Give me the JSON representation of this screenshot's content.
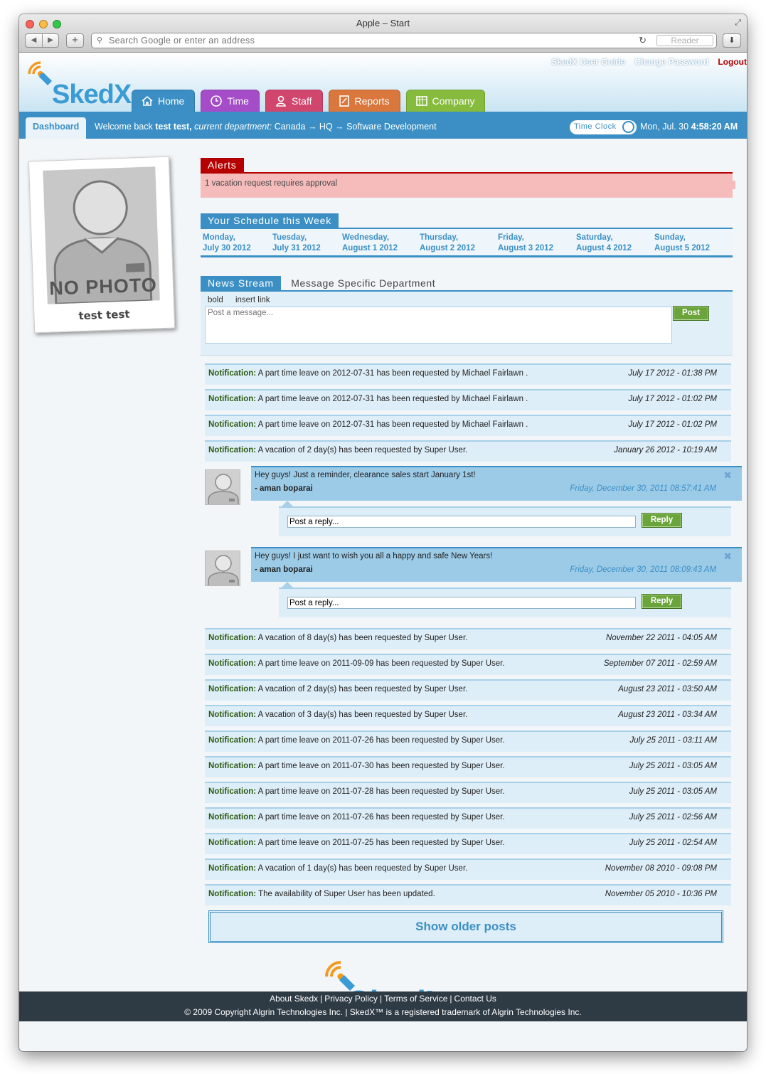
{
  "browser": {
    "title": "Apple – Start",
    "address_placeholder": "Search Google or enter an address",
    "reader_label": "Reader"
  },
  "brand": {
    "logo_text": "SkedX",
    "accent": "#3b8fc4"
  },
  "toplinks": [
    "SkedX User Guide",
    "Change Password",
    "Logout"
  ],
  "tabs": [
    {
      "label": "Home",
      "color": "#3b8fc4",
      "icon": "home-icon"
    },
    {
      "label": "Time",
      "color": "#a54dc8",
      "icon": "clock-icon"
    },
    {
      "label": "Staff",
      "color": "#d1466d",
      "icon": "person-icon"
    },
    {
      "label": "Reports",
      "color": "#d9773d",
      "icon": "report-icon"
    },
    {
      "label": "Company",
      "color": "#86bb3d",
      "icon": "calendar-icon"
    }
  ],
  "subbar": {
    "dashboard": "Dashboard",
    "welcome_prefix": "Welcome back",
    "user": "test test,",
    "dept_label": "current department:",
    "dept_path": "Canada → HQ → Software Development",
    "time_clock": "Time Clock",
    "date": "Mon, Jul. 30",
    "time": "4:58:20 AM"
  },
  "profile": {
    "photo_text": "NO PHOTO",
    "name": "test test"
  },
  "alerts": {
    "title": "Alerts",
    "message": "1 vacation request requires approval"
  },
  "schedule": {
    "title": "Your Schedule this Week",
    "days": [
      {
        "day": "Monday,",
        "date": "July 30 2012"
      },
      {
        "day": "Tuesday,",
        "date": "July 31 2012"
      },
      {
        "day": "Wednesday,",
        "date": "August 1 2012"
      },
      {
        "day": "Thursday,",
        "date": "August 2 2012"
      },
      {
        "day": "Friday,",
        "date": "August 3 2012"
      },
      {
        "day": "Saturday,",
        "date": "August 4 2012"
      },
      {
        "day": "Sunday,",
        "date": "August 5 2012"
      }
    ]
  },
  "news": {
    "title": "News Stream",
    "subtitle": "Message Specific Department",
    "tool_bold": "bold",
    "tool_link": "insert link",
    "placeholder": "Post a message...",
    "post_label": "Post",
    "reply_placeholder": "Post a reply...",
    "reply_label": "Reply",
    "older_label": "Show older posts"
  },
  "feed": [
    {
      "type": "notif",
      "label": "Notification:",
      "text": "A part time leave on 2012-07-31 has been requested by Michael Fairlawn .",
      "date": "July 17 2012 - 01:38 PM"
    },
    {
      "type": "notif",
      "label": "Notification:",
      "text": "A part time leave on 2012-07-31 has been requested by Michael Fairlawn .",
      "date": "July 17 2012 - 01:02 PM"
    },
    {
      "type": "notif",
      "label": "Notification:",
      "text": "A part time leave on 2012-07-31 has been requested by Michael Fairlawn .",
      "date": "July 17 2012 - 01:02 PM"
    },
    {
      "type": "notif",
      "label": "Notification:",
      "text": "A vacation of 2 day(s) has been requested by Super User.",
      "date": "January 26 2012 - 10:19 AM"
    },
    {
      "type": "msg",
      "text": "Hey guys! Just a reminder, clearance sales start January 1st!",
      "author": "- aman boparai",
      "date": "Friday, December 30, 2011 08:57:41 AM"
    },
    {
      "type": "msg",
      "text": "Hey guys! I just want to wish you all a happy and safe New Years!",
      "author": "- aman boparai",
      "date": "Friday, December 30, 2011 08:09:43 AM"
    },
    {
      "type": "notif",
      "label": "Notification:",
      "text": "A vacation of 8 day(s) has been requested by Super User.",
      "date": "November 22 2011 - 04:05 AM"
    },
    {
      "type": "notif",
      "label": "Notification:",
      "text": "A part time leave on 2011-09-09 has been requested by Super User.",
      "date": "September 07 2011 - 02:59 AM"
    },
    {
      "type": "notif",
      "label": "Notification:",
      "text": "A vacation of 2 day(s) has been requested by Super User.",
      "date": "August 23 2011 - 03:50 AM"
    },
    {
      "type": "notif",
      "label": "Notification:",
      "text": "A vacation of 3 day(s) has been requested by Super User.",
      "date": "August 23 2011 - 03:34 AM"
    },
    {
      "type": "notif",
      "label": "Notification:",
      "text": "A part time leave on 2011-07-26 has been requested by Super User.",
      "date": "July 25 2011 - 03:11 AM"
    },
    {
      "type": "notif",
      "label": "Notification:",
      "text": "A part time leave on 2011-07-30 has been requested by Super User.",
      "date": "July 25 2011 - 03:05 AM"
    },
    {
      "type": "notif",
      "label": "Notification:",
      "text": "A part time leave on 2011-07-28 has been requested by Super User.",
      "date": "July 25 2011 - 03:05 AM"
    },
    {
      "type": "notif",
      "label": "Notification:",
      "text": "A part time leave on 2011-07-26 has been requested by Super User.",
      "date": "July 25 2011 - 02:56 AM"
    },
    {
      "type": "notif",
      "label": "Notification:",
      "text": "A part time leave on 2011-07-25 has been requested by Super User.",
      "date": "July 25 2011 - 02:54 AM"
    },
    {
      "type": "notif",
      "label": "Notification:",
      "text": "A vacation of 1 day(s) has been requested by Super User.",
      "date": "November 08 2010 - 09:08 PM"
    },
    {
      "type": "notif",
      "label": "Notification:",
      "text": "The availability of Super User has been updated.",
      "date": "November 05 2010 - 10:36 PM"
    }
  ],
  "footer": {
    "links": [
      "About Skedx",
      "Privacy Policy",
      "Terms of Service",
      "Contact Us"
    ],
    "copyright": "© 2009 Copyright Algrin Technologies Inc. | SkedX™ is a registered trademark of Algrin Technologies Inc."
  }
}
